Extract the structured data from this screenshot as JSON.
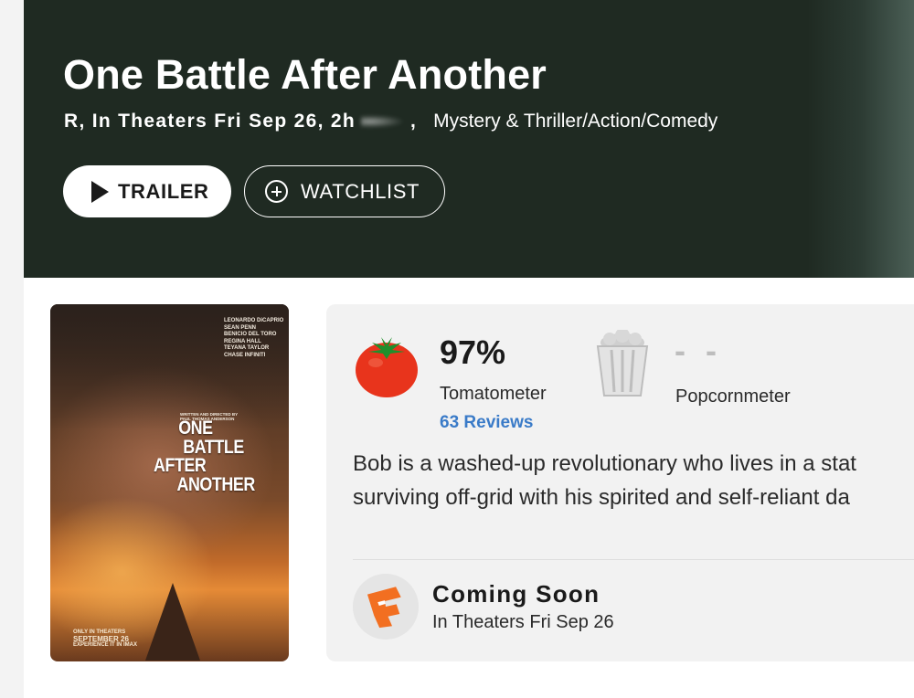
{
  "movie": {
    "title": "One Battle After Another",
    "meta_rating": "R, In Theaters Fri Sep 26, 2h",
    "meta_separator": ",",
    "genres": "Mystery & Thriller/Action/Comedy"
  },
  "actions": {
    "trailer_label": "TRAILER",
    "watchlist_label": "WATCHLIST"
  },
  "poster": {
    "cast": [
      "LEONARDO DiCAPRIO",
      "SEAN PENN",
      "BENICIO DEL TORO",
      "REGINA HALL",
      "TEYANA TAYLOR",
      "CHASE INFINITI"
    ],
    "credit": "WRITTEN AND DIRECTED BY PAUL THOMAS ANDERSON",
    "title_lines": [
      "ONE",
      "BATTLE",
      "AFTER",
      "ANOTHER"
    ],
    "release_line1": "ONLY IN THEATERS",
    "release_line2": "SEPTEMBER 26",
    "release_line3": "EXPERIENCE IT IN IMAX"
  },
  "scores": {
    "tomatometer_value": "97%",
    "tomatometer_label": "Tomatometer",
    "reviews_link": "63 Reviews",
    "popcornmeter_value": "- -",
    "popcornmeter_label": "Popcornmeter"
  },
  "synopsis": {
    "line1": "Bob is a washed-up revolutionary who lives in a stat",
    "line2": "surviving off-grid with his spirited and self-reliant da"
  },
  "availability": {
    "title": "Coming Soon",
    "subtitle": "In Theaters Fri Sep 26"
  },
  "colors": {
    "hero_bg": "#1f2a22",
    "link_blue": "#3a7bc8",
    "tomato_red": "#e8341c",
    "fandango_orange": "#f26f21"
  },
  "icons": [
    "play-icon",
    "plus-circle-icon",
    "tomato-icon",
    "popcorn-bucket-icon",
    "fandango-icon"
  ]
}
